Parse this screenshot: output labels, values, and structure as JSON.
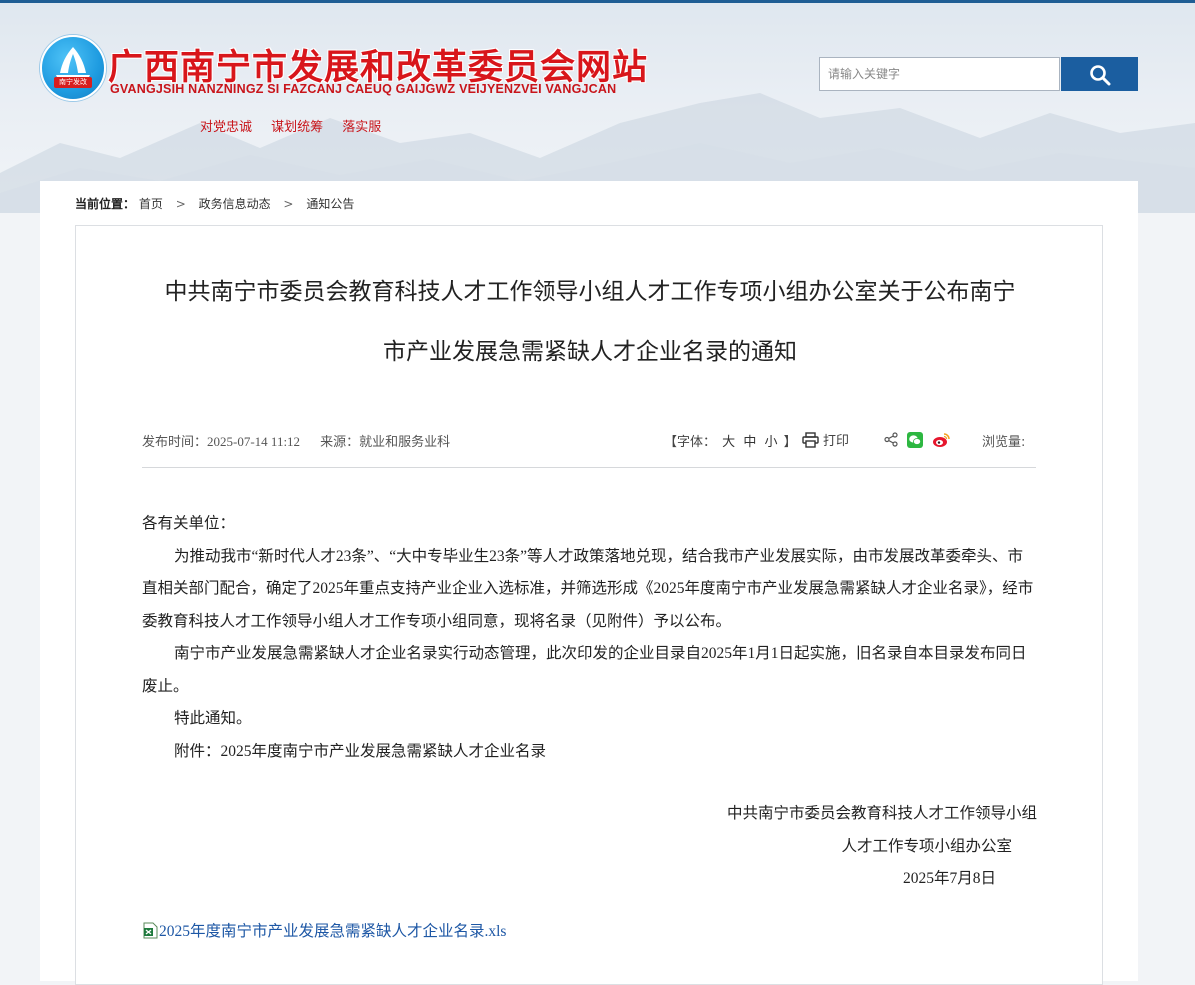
{
  "header": {
    "site_title": "广西南宁市发展和改革委员会网站",
    "site_subtitle": "GVANGJSIH NANZNINGZ SI FAZCANJ CAEUQ GAIJGWZ VEIJYENZVEI VANGJCAN",
    "logo_badge": "南宁发改",
    "slogans": [
      "对党忠诚",
      "谋划统筹",
      "落实服"
    ],
    "search_placeholder": "请输入关键字"
  },
  "breadcrumb": {
    "label": "当前位置：",
    "items": [
      "首页",
      "政务信息动态",
      "通知公告"
    ],
    "separator": ">"
  },
  "article": {
    "title_line1": "中共南宁市委员会教育科技人才工作领导小组人才工作专项小组办公室关于公布南宁",
    "title_line2": "市产业发展急需紧缺人才企业名录的通知",
    "publish_label": "发布时间：",
    "publish_time": "2025-07-14 11:12",
    "source_label": "来源：",
    "source": "就业和服务业科",
    "font_size_label_open": "【字体：",
    "font_size_options": [
      "大",
      "中",
      "小"
    ],
    "font_size_label_close": "】",
    "print_label": "打印",
    "views_label": "浏览量:",
    "salutation": "各有关单位：",
    "paragraphs": [
      "为推动我市“新时代人才23条”、“大中专毕业生23条”等人才政策落地兑现，结合我市产业发展实际，由市发展改革委牵头、市直相关部门配合，确定了2025年重点支持产业企业入选标准，并筛选形成《2025年度南宁市产业发展急需紧缺人才企业名录》，经市委教育科技人才工作领导小组人才工作专项小组同意，现将名录（见附件）予以公布。",
      "南宁市产业发展急需紧缺人才企业名录实行动态管理，此次印发的企业目录自2025年1月1日起实施，旧名录自本目录发布同日废止。",
      "特此通知。",
      "附件：2025年度南宁市产业发展急需紧缺人才企业名录"
    ],
    "signature_line1": "中共南宁市委员会教育科技人才工作领导小组",
    "signature_line2": "人才工作专项小组办公室",
    "signature_date": "2025年7月8日",
    "attachment_link": "2025年度南宁市产业发展急需紧缺人才企业名录.xls"
  },
  "colors": {
    "title_red": "#d8161b",
    "search_button": "#1b5ea0",
    "link_blue": "#1d57a5"
  }
}
